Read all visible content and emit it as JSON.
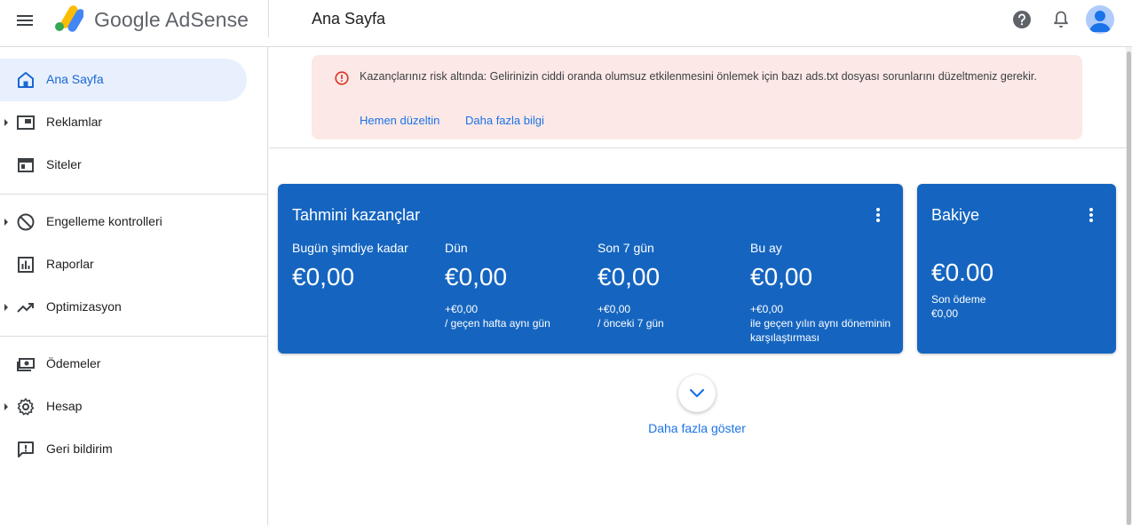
{
  "header": {
    "brand_google": "Google",
    "brand_product": "AdSense",
    "page_title": "Ana Sayfa"
  },
  "sidebar": {
    "items": [
      {
        "label": "Ana Sayfa",
        "icon": "home-icon",
        "active": true
      },
      {
        "label": "Reklamlar",
        "icon": "ads-icon",
        "expandable": true
      },
      {
        "label": "Siteler",
        "icon": "sites-icon"
      },
      {
        "label": "Engelleme kontrolleri",
        "icon": "block-icon",
        "expandable": true
      },
      {
        "label": "Raporlar",
        "icon": "reports-icon"
      },
      {
        "label": "Optimizasyon",
        "icon": "trending-up-icon",
        "expandable": true
      },
      {
        "label": "Ödemeler",
        "icon": "payments-icon"
      },
      {
        "label": "Hesap",
        "icon": "gear-icon",
        "expandable": true
      },
      {
        "label": "Geri bildirim",
        "icon": "feedback-icon"
      }
    ]
  },
  "alert": {
    "message": "Kazançlarınız risk altında: Gelirinizin ciddi oranda olumsuz etkilenmesini önlemek için bazı ads.txt dosyası sorunlarını düzeltmeniz gerekir.",
    "fix_link": "Hemen düzeltin",
    "learn_link": "Daha fazla bilgi"
  },
  "earnings": {
    "title": "Tahmini kazançlar",
    "metrics": [
      {
        "label": "Bugün şimdiye kadar",
        "value": "€0,00",
        "delta": "",
        "compare": ""
      },
      {
        "label": "Dün",
        "value": "€0,00",
        "delta": "+€0,00",
        "compare": "/ geçen hafta aynı gün"
      },
      {
        "label": "Son 7 gün",
        "value": "€0,00",
        "delta": "+€0,00",
        "compare": "/ önceki 7 gün"
      },
      {
        "label": "Bu ay",
        "value": "€0,00",
        "delta": "+€0,00",
        "compare": "ile geçen yılın aynı döneminin karşılaştırması"
      }
    ]
  },
  "balance": {
    "title": "Bakiye",
    "value": "€0.00",
    "last_payment_label": "Son ödeme",
    "last_payment_value": "€0,00"
  },
  "show_more": {
    "label": "Daha fazla göster"
  },
  "colors": {
    "card_blue": "#1565c0",
    "link_blue": "#1a73e8",
    "alert_bg": "#fce8e6",
    "error_red": "#d93025",
    "active_nav_bg": "#e8f0fe"
  }
}
